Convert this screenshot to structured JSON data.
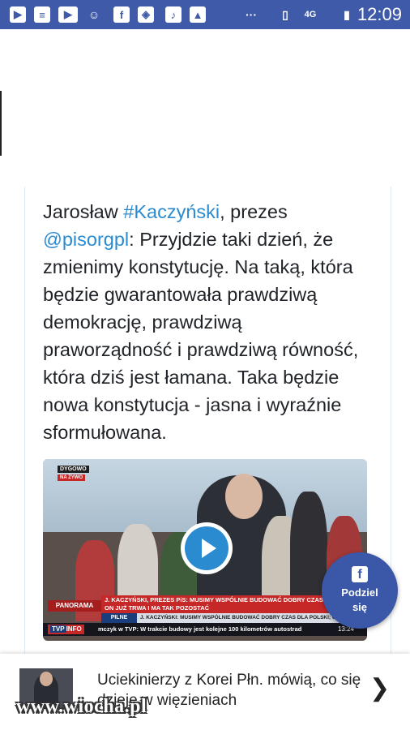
{
  "status_bar": {
    "time": "12:09",
    "icons": [
      "video-message-icon",
      "news-icon",
      "youtube-icon",
      "emoji-icon",
      "facebook-icon",
      "maps-icon",
      "music-icon",
      "gallery-icon",
      "more-icon",
      "vibrate-icon",
      "signal-icon",
      "battery-icon"
    ],
    "more": "···",
    "vibrate": "▯",
    "network": "4G",
    "battery": "▮"
  },
  "tweet": {
    "part1": "Jarosław ",
    "hashtag": "#Kaczyński",
    "part2": ", prezes ",
    "mention": "@pisorgpl",
    "part3": ": Przyjdzie taki dzień, że zmienimy konstytucję. Na taką, która będzie gwarantowała prawdziwą demokrację, prawdziwą praworządność i prawdziwą równość, która dziś jest łamana. Taka będzie nowa konstytucja - jasna i wyraźnie sformułowana."
  },
  "video": {
    "location": "DYGOWO",
    "live": "NA ŻYWO",
    "program": "PANORAMA",
    "headline": "J. KACZYŃSKI, PREZES PiS: MUSIMY WSPÓLNIE BUDOWAĆ DOBRY CZAS DLA POLSKI, ON JUŻ TRWA I MA TAK POZOSTAĆ",
    "pilne": "PILNE",
    "pilne_text": "J. KACZYŃSKI: MUSIMY WSPÓLNIE BUDOWAĆ DOBRY CZAS DLA POLSKI; ON JUŻ SIĘ ROZPOCZĄŁ",
    "channel_a": "TVP",
    "channel_b": "INFO",
    "ticker": "mczyk w TVP: W trakcie budowy jest kolejne 100 kilometrów autostrad",
    "clock": "13:24"
  },
  "share": {
    "icon_letter": "f",
    "label": "Podziel się"
  },
  "bottom": {
    "article_title": "Uciekinierzy z Korei Płn. mówią, co się dzieje w więzieniach",
    "chevron": "❯"
  },
  "watermark": "www.wiocha.pl",
  "colors": {
    "status_bar": "#3f5aa8",
    "link": "#2b8bd1",
    "share_button": "#3b57a8",
    "ticker_red": "#c62828"
  }
}
